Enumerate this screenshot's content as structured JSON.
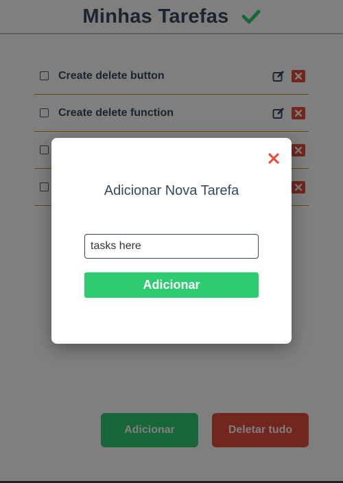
{
  "header": {
    "title": "Minhas Tarefas",
    "icon": "checkmark-icon"
  },
  "tasks": [
    {
      "text": "Create delete button",
      "checked": false
    },
    {
      "text": "Create delete function",
      "checked": false
    },
    {
      "text": "",
      "checked": false
    },
    {
      "text": "",
      "checked": false
    }
  ],
  "footer": {
    "add_label": "Adicionar",
    "delete_all_label": "Deletar tudo"
  },
  "modal": {
    "title": "Adicionar Nova Tarefa",
    "input_placeholder": "tasks here",
    "input_value": "",
    "submit_label": "Adicionar",
    "close_icon": "close-icon"
  },
  "colors": {
    "heading": "#34495e",
    "accent_green": "#2ecc71",
    "accent_red": "#e74c3c",
    "row_border": "#d38b1e"
  }
}
